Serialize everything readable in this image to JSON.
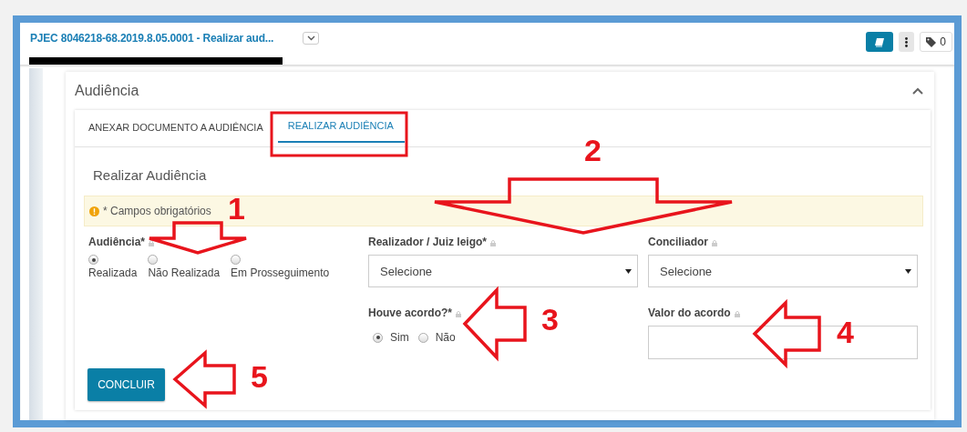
{
  "header": {
    "title": "PJEC 8046218-68.2019.8.05.0001 - Realizar aud...",
    "tag_count": "0"
  },
  "panel": {
    "title": "Audiência",
    "expanded": true
  },
  "tabs": [
    {
      "label": "ANEXAR DOCUMENTO A AUDIÊNCIA",
      "selected": false
    },
    {
      "label": "REALIZAR AUDIÊNCIA",
      "selected": true
    }
  ],
  "form": {
    "title": "Realizar Audiência",
    "alert": "* Campos obrigatórios",
    "audiencia": {
      "label": "Audiência*",
      "options": [
        {
          "label": "Realizada",
          "selected": true
        },
        {
          "label": "Não Realizada",
          "selected": false
        },
        {
          "label": "Em Prosseguimento",
          "selected": false
        }
      ]
    },
    "realizador": {
      "label": "Realizador / Juiz leigo*",
      "value": "Selecione"
    },
    "conciliador": {
      "label": "Conciliador",
      "value": "Selecione"
    },
    "acordo": {
      "label": "Houve acordo?*",
      "options": [
        {
          "label": "Sim",
          "selected": true
        },
        {
          "label": "Não",
          "selected": false
        }
      ]
    },
    "valor": {
      "label": "Valor do acordo"
    },
    "submit": "CONCLUIR"
  },
  "annotations": [
    {
      "label": "1",
      "kind": "down"
    },
    {
      "label": "2",
      "kind": "down"
    },
    {
      "label": "3",
      "kind": "left"
    },
    {
      "label": "4",
      "kind": "left"
    },
    {
      "label": "5",
      "kind": "left"
    }
  ]
}
